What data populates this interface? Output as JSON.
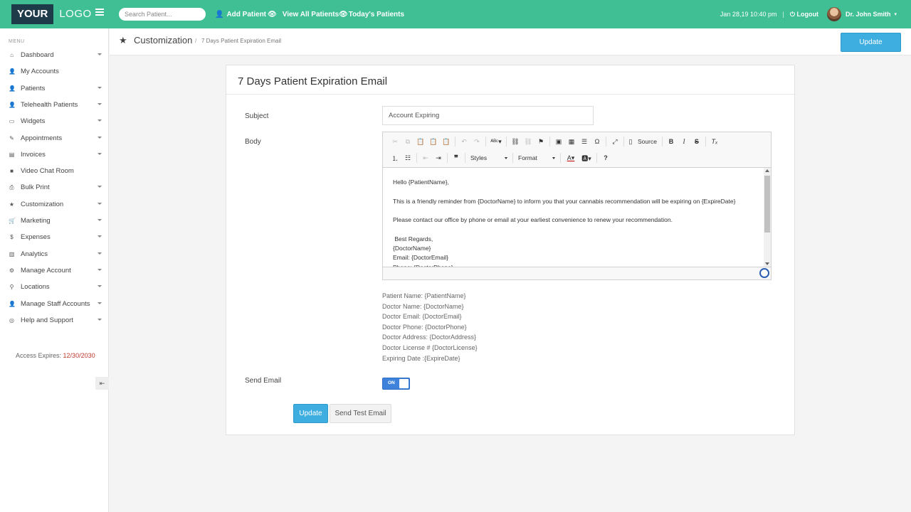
{
  "topbar": {
    "logo_left": "YOUR",
    "logo_right": "LOGO",
    "search_placeholder": "Search Patient...",
    "nav": [
      {
        "icon": "add-user-icon",
        "glyph": "👤",
        "label": "Add Patient"
      },
      {
        "icon": "eye-icon",
        "glyph": "👁",
        "label": "View All Patients"
      },
      {
        "icon": "eye-icon",
        "glyph": "👁",
        "label": "Today's Patients"
      }
    ],
    "datetime": "Jan 28,19 10:40 pm",
    "separator": "|",
    "logout_label": "Logout",
    "user_name": "Dr. John Smith"
  },
  "sidebar": {
    "menu_label": "MENU",
    "items": [
      {
        "label": "Dashboard",
        "glyph": "⌂",
        "caret": true
      },
      {
        "label": "My Accounts",
        "glyph": "👤",
        "caret": false
      },
      {
        "label": "Patients",
        "glyph": "👤",
        "caret": true
      },
      {
        "label": "Telehealth Patients",
        "glyph": "👤",
        "caret": true
      },
      {
        "label": "Widgets",
        "glyph": "▭",
        "caret": true
      },
      {
        "label": "Appointments",
        "glyph": "✎",
        "caret": true
      },
      {
        "label": "Invoices",
        "glyph": "▤",
        "caret": true
      },
      {
        "label": "Video Chat Room",
        "glyph": "■",
        "caret": false
      },
      {
        "label": "Bulk Print",
        "glyph": "⎙",
        "caret": true
      },
      {
        "label": "Customization",
        "glyph": "★",
        "caret": true
      },
      {
        "label": "Marketing",
        "glyph": "🛒",
        "caret": true
      },
      {
        "label": "Expenses",
        "glyph": "$",
        "caret": true
      },
      {
        "label": "Analytics",
        "glyph": "▥",
        "caret": true
      },
      {
        "label": "Manage Account",
        "glyph": "⚙",
        "caret": true
      },
      {
        "label": "Locations",
        "glyph": "⚲",
        "caret": true
      },
      {
        "label": "Manage Staff Accounts",
        "glyph": "👤",
        "caret": true
      },
      {
        "label": "Help and Support",
        "glyph": "◎",
        "caret": true
      }
    ],
    "access_label": "Access Expires:",
    "access_date": "12/30/2030"
  },
  "breadcrumb": {
    "title": "Customization",
    "separator": "/",
    "current": "7 Days Patient Expiration Email"
  },
  "header_update_label": "Update",
  "form": {
    "panel_title": "7 Days Patient Expiration Email",
    "subject_label": "Subject",
    "subject_value": "Account Expiring",
    "body_label": "Body",
    "toolbar": {
      "source_label": "Source",
      "styles_label": "Styles",
      "format_label": "Format"
    },
    "body_lines": [
      "Hello {PatientName},",
      "",
      "This is a friendly reminder from {DoctorName} to inform you that your cannabis recommendation will be expiring on {ExpireDate}",
      "",
      "Please contact our office by phone or email at your earliest convenience to renew your recommendation.",
      "",
      " Best Regards,",
      "{DoctorName}",
      "Email: {DoctorEmail}",
      "Phone: {DoctorPhone}"
    ],
    "placeholders": [
      "Patient Name: {PatientName}",
      "Doctor Name: {DoctorName}",
      "Doctor Email: {DoctorEmail}",
      "Doctor Phone: {DoctorPhone}",
      "Doctor Address: {DoctorAddress}",
      "Doctor License # {DoctorLicense}",
      "Expiring Date :{ExpireDate}"
    ],
    "send_email_label": "Send Email",
    "toggle_label": "ON",
    "toggle_state": true,
    "update_label": "Update",
    "send_test_label": "Send Test Email"
  },
  "colors": {
    "topbar": "#3fbf93",
    "logo_dark": "#1e3b4a",
    "primary_button": "#3eaee0",
    "toggle": "#3e82dc",
    "access_date": "#c0392b"
  }
}
